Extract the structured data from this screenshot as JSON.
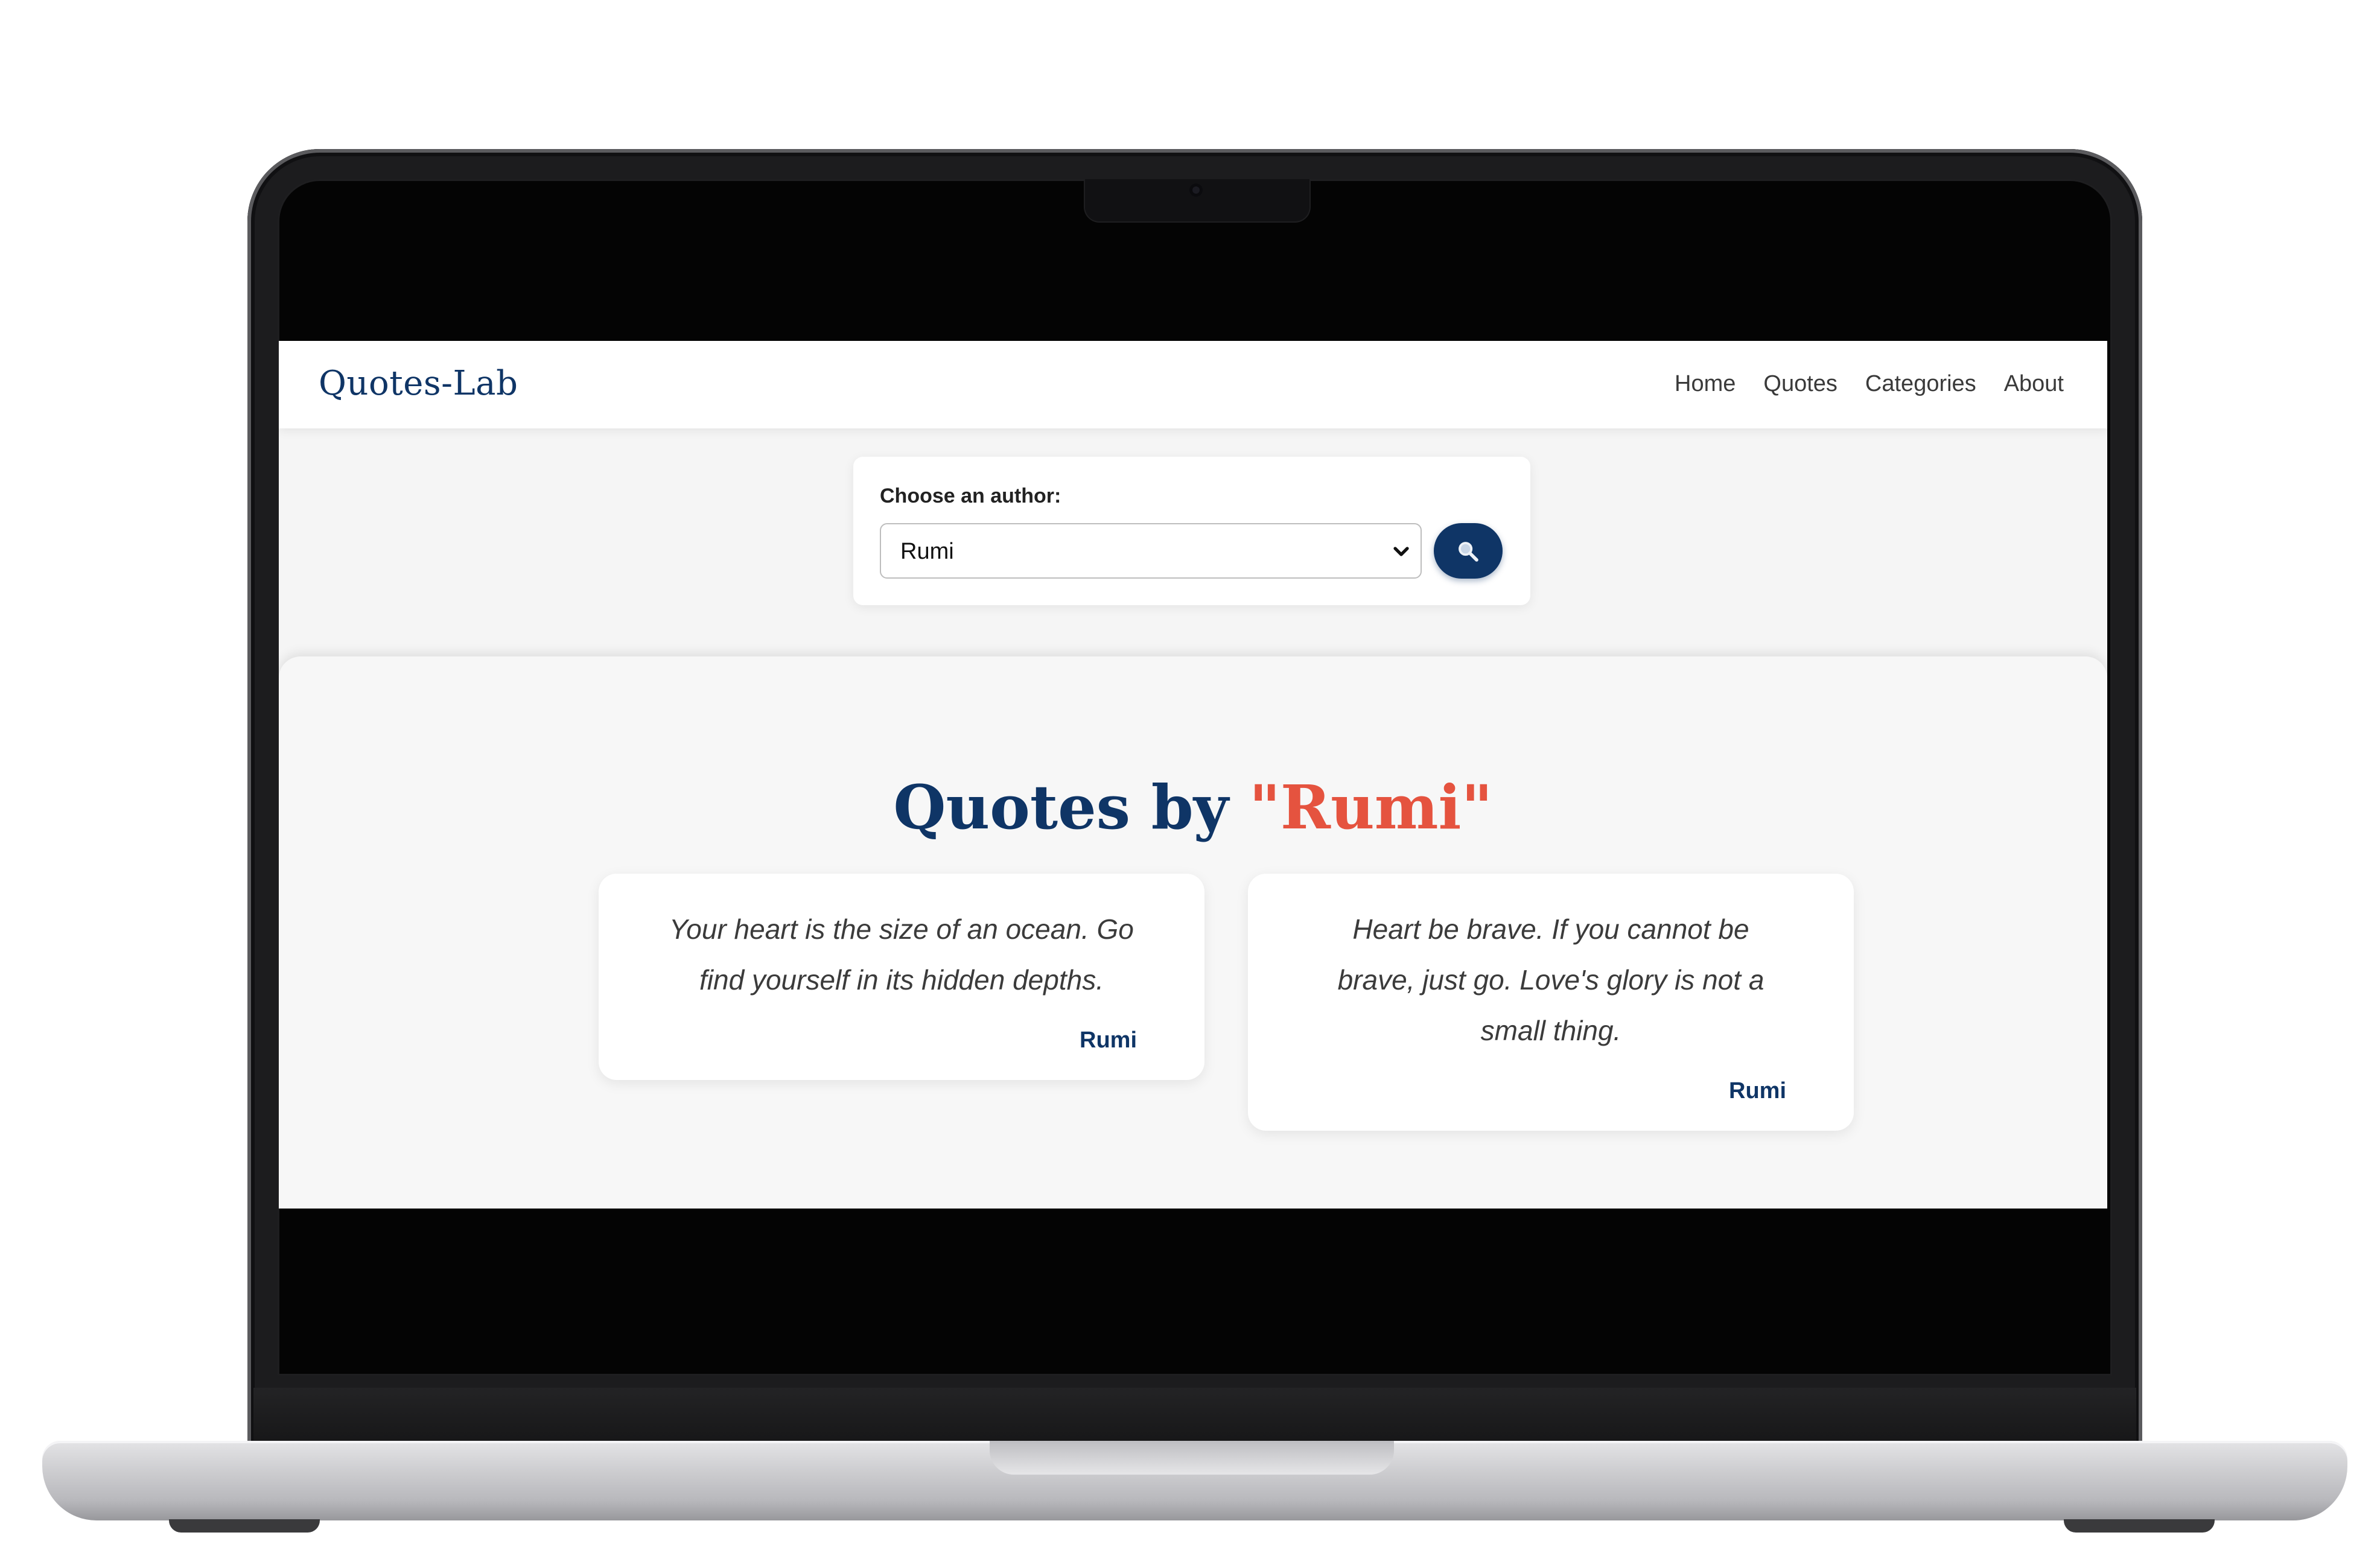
{
  "navbar": {
    "brand": "Quotes-Lab",
    "links": [
      "Home",
      "Quotes",
      "Categories",
      "About"
    ]
  },
  "search": {
    "label": "Choose an author:",
    "selected_author": "Rumi",
    "button_icon": "search-icon"
  },
  "results": {
    "heading_prefix": "Quotes by",
    "heading_author": "\"Rumi\"",
    "quotes": [
      {
        "text": "Your heart is the size of an ocean. Go find yourself in its hidden depths.",
        "author": "Rumi"
      },
      {
        "text": "Heart be brave. If you cannot be brave, just go. Love's glory is not a small thing.",
        "author": "Rumi"
      }
    ]
  },
  "colors": {
    "brand_navy": "#0f3566",
    "accent_coral": "#e5533f",
    "page_background": "#f5f5f5"
  }
}
